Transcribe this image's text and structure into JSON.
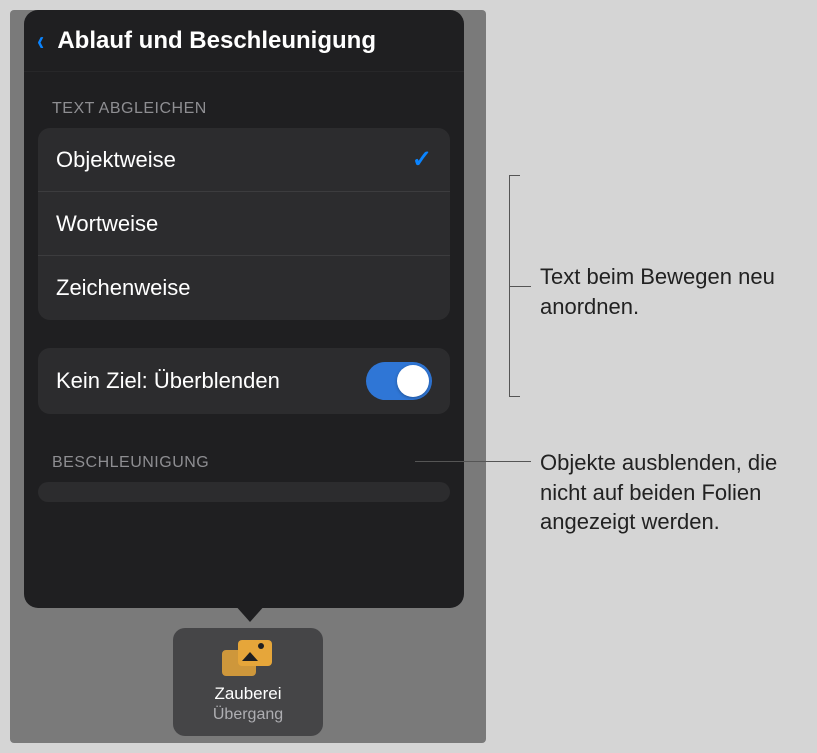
{
  "header": {
    "title": "Ablauf und Beschleunigung"
  },
  "sections": {
    "textMatch": {
      "label": "TEXT ABGLEICHEN",
      "options": [
        {
          "label": "Objektweise",
          "selected": true
        },
        {
          "label": "Wortweise",
          "selected": false
        },
        {
          "label": "Zeichenweise",
          "selected": false
        }
      ]
    },
    "noTarget": {
      "label": "Kein Ziel: Überblenden",
      "on": true
    },
    "acceleration": {
      "label": "BESCHLEUNIGUNG"
    }
  },
  "transitionChip": {
    "name": "Zauberei",
    "subtitle": "Übergang"
  },
  "callouts": {
    "textMatch": "Text beim Bewegen neu anordnen.",
    "fade": "Objekte ausblenden, die nicht auf beiden Folien angezeigt werden."
  }
}
